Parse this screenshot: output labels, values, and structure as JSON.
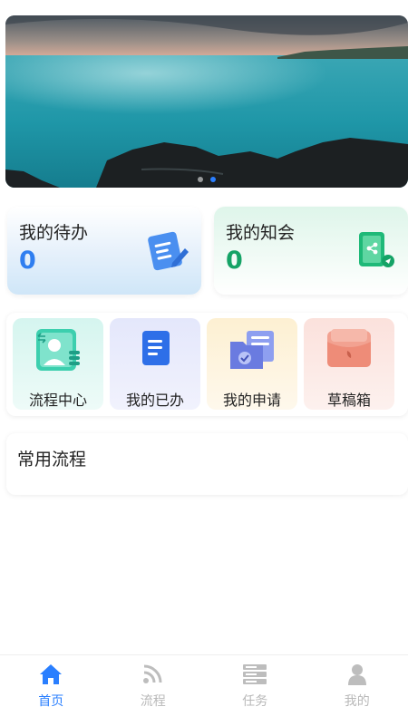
{
  "banner": {
    "dots": [
      {
        "active": false
      },
      {
        "active": true
      }
    ]
  },
  "cards": {
    "todo": {
      "title": "我的待办",
      "count": "0"
    },
    "know": {
      "title": "我的知会",
      "count": "0"
    }
  },
  "quick": {
    "items": [
      {
        "label": "流程中心",
        "icon": "process-center-icon"
      },
      {
        "label": "我的已办",
        "icon": "document-done-icon"
      },
      {
        "label": "我的申请",
        "icon": "application-folder-icon"
      },
      {
        "label": "草稿箱",
        "icon": "draft-box-icon"
      }
    ]
  },
  "common": {
    "title": "常用流程"
  },
  "tabbar": {
    "active_color": "#2a7fff",
    "items": [
      {
        "label": "首页",
        "icon": "home-icon",
        "active": true
      },
      {
        "label": "流程",
        "icon": "feed-icon",
        "active": false
      },
      {
        "label": "任务",
        "icon": "server-icon",
        "active": false
      },
      {
        "label": "我的",
        "icon": "user-icon",
        "active": false
      }
    ]
  }
}
